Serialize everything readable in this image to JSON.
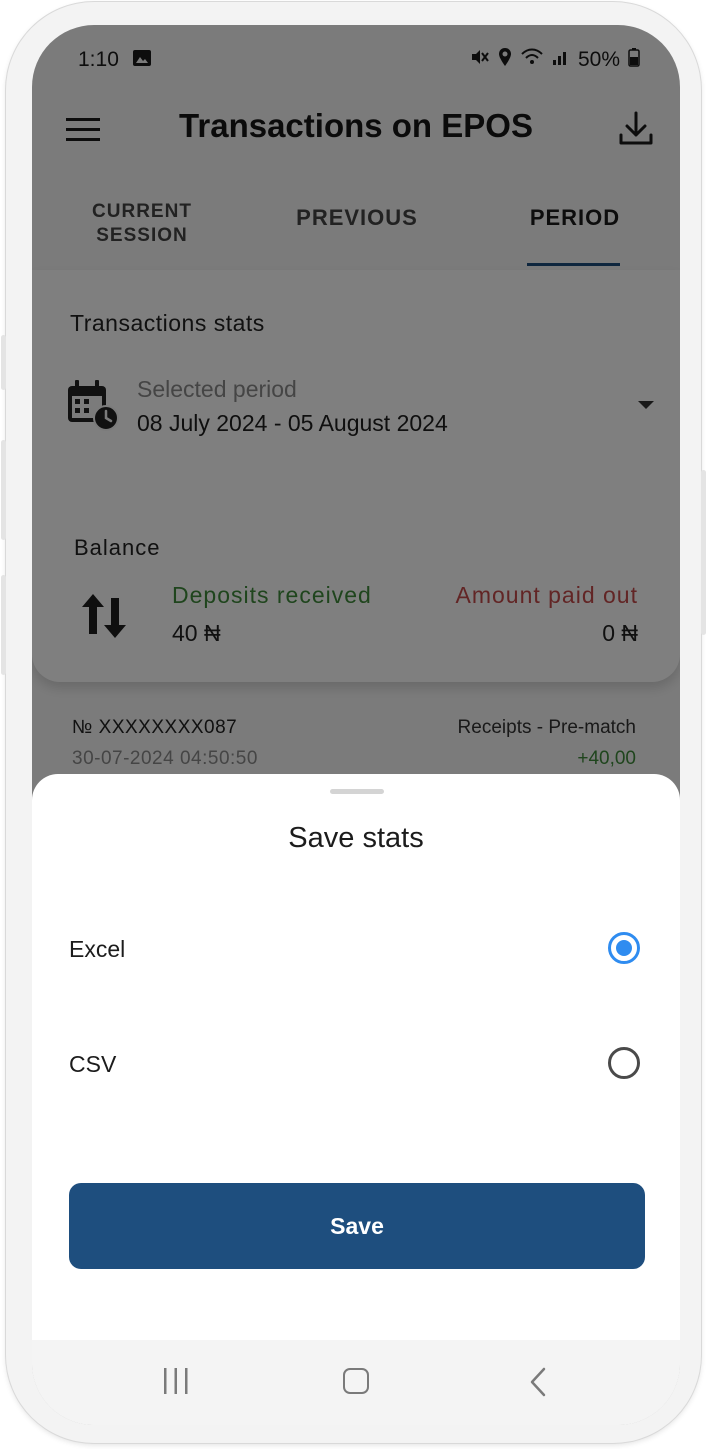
{
  "status_bar": {
    "time": "1:10",
    "battery": "50%"
  },
  "app_bar": {
    "title": "Transactions on EPOS"
  },
  "tabs": [
    {
      "label_line1": "CURRENT",
      "label_line2": "SESSION"
    },
    {
      "label": "PREVIOUS"
    },
    {
      "label": "PERIOD",
      "active": true
    }
  ],
  "stats": {
    "title": "Transactions stats",
    "period_label": "Selected period",
    "period_value": "08 July 2024 - 05 August 2024",
    "balance_title": "Balance",
    "deposits_label": "Deposits received",
    "deposits_value": "40 ₦",
    "payout_label": "Amount paid out",
    "payout_value": "0 ₦"
  },
  "transaction": {
    "number": "№ XXXXXXXX087",
    "date": "30-07-2024 04:50:50",
    "type": "Receipts - Pre-match",
    "amount": "+40,00"
  },
  "sheet": {
    "title": "Save stats",
    "options": [
      {
        "label": "Excel",
        "selected": true
      },
      {
        "label": "CSV",
        "selected": false
      }
    ],
    "save_label": "Save"
  },
  "colors": {
    "primary": "#1e4e7e",
    "radio_selected": "#2f8cf0",
    "positive": "#3f8a3a",
    "negative": "#c44a4a"
  },
  "icons": [
    "image-icon",
    "mute-icon",
    "location-icon",
    "wifi-icon",
    "signal-icon",
    "battery-icon",
    "menu-icon",
    "download-icon",
    "calendar-clock-icon",
    "dropdown-icon",
    "swap-arrows-icon",
    "recents-icon",
    "home-icon",
    "back-icon"
  ]
}
